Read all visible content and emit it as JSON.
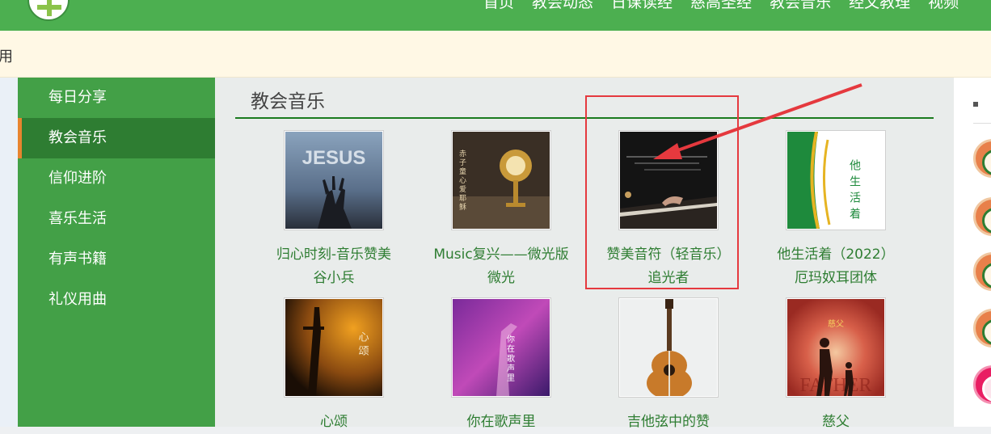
{
  "nav": [
    "首页",
    "教会动态",
    "日课读经",
    "慈高圣经",
    "教会音乐",
    "经文教理",
    "视频"
  ],
  "notice_text": "用",
  "sidebar": {
    "items": [
      {
        "label": "每日分享",
        "active": false
      },
      {
        "label": "教会音乐",
        "active": true
      },
      {
        "label": "信仰进阶",
        "active": false
      },
      {
        "label": "喜乐生活",
        "active": false
      },
      {
        "label": "有声书籍",
        "active": false
      },
      {
        "label": "礼仪用曲",
        "active": false
      }
    ]
  },
  "main": {
    "title": "教会音乐",
    "albums": [
      {
        "line1": "归心时刻-音乐赞美",
        "line2": "谷小兵",
        "art_label": "JESUS",
        "art": "jesus"
      },
      {
        "line1": "Music复兴——微光版",
        "line2": "微光",
        "art_label": "赤子童心爱耶稣",
        "art": "monstrance"
      },
      {
        "line1": "赞美音符（轻音乐）",
        "line2": "追光者",
        "art": "piano"
      },
      {
        "line1": "他生活着（2022）",
        "line2": "厄玛奴耳团体",
        "art_label": "他生活着",
        "art": "hestlives"
      },
      {
        "line1": "心颂",
        "line2": "",
        "art_label": "心颂",
        "art": "cross"
      },
      {
        "line1": "你在歌声里",
        "line2": "",
        "art_label": "你在歌声里",
        "art": "purple"
      },
      {
        "line1": "吉他弦中的赞",
        "line2": "",
        "art": "guitar"
      },
      {
        "line1": "慈父",
        "line2": "",
        "art_label": "慈父",
        "art_label2": "FATHER",
        "art": "father"
      }
    ]
  },
  "colors": {
    "header_green": "#4caf50",
    "sidebar_green": "#43a047",
    "sidebar_active": "#2e7d32",
    "active_accent": "#e8842f",
    "link_green": "#2e7d32",
    "highlight_red": "#e5393e"
  }
}
